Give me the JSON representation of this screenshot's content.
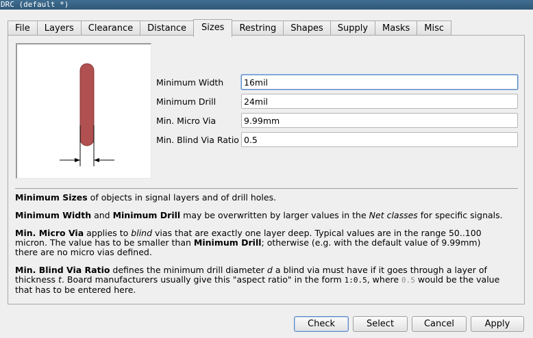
{
  "window": {
    "title": "DRC (default *)"
  },
  "tabs": [
    "File",
    "Layers",
    "Clearance",
    "Distance",
    "Sizes",
    "Restring",
    "Shapes",
    "Supply",
    "Masks",
    "Misc"
  ],
  "active_tab": "Sizes",
  "preview": {
    "icon": "via-width-diagram-icon",
    "trace_color": "#b05050"
  },
  "fields": [
    {
      "label": "Minimum Width",
      "value": "16mil"
    },
    {
      "label": "Minimum Drill",
      "value": "24mil"
    },
    {
      "label": "Min. Micro Via",
      "value": "9.99mm"
    },
    {
      "label": "Min. Blind Via Ratio",
      "value": "0.5"
    }
  ],
  "description": {
    "p1": {
      "b1": "Minimum Sizes",
      "t1": " of objects in signal layers and of drill holes."
    },
    "p2": {
      "b1": "Minimum Width",
      "t1": " and ",
      "b2": "Minimum Drill",
      "t2": " may be overwritten by larger values in the ",
      "i1": "Net classes",
      "t3": " for specific signals."
    },
    "p3": {
      "b1": "Min. Micro Via",
      "t1": " applies to ",
      "i1": "blind",
      "t2": " vias that are exactly one layer deep. Typical values are in the range 50..100 micron. The value has to be smaller than ",
      "b2": "Minimum Drill",
      "t3": "; otherwise (e.g. with the default value of 9.99mm) there are no micro vias defined."
    },
    "p4": {
      "b1": "Min. Blind Via Ratio",
      "t1": " defines the minimum drill diameter ",
      "i1": "d",
      "t2": " a blind via must have if it goes through a layer of thickness ",
      "i2": "t",
      "t3": ". Board manufacturers usually give this \"aspect ratio\" in the form ",
      "m1": "1:0.5",
      "t4": ", where ",
      "m2": "0.5",
      "t5": " would be the value that has to be entered here."
    }
  },
  "buttons": {
    "check": "Check",
    "select": "Select",
    "cancel": "Cancel",
    "apply": "Apply"
  }
}
